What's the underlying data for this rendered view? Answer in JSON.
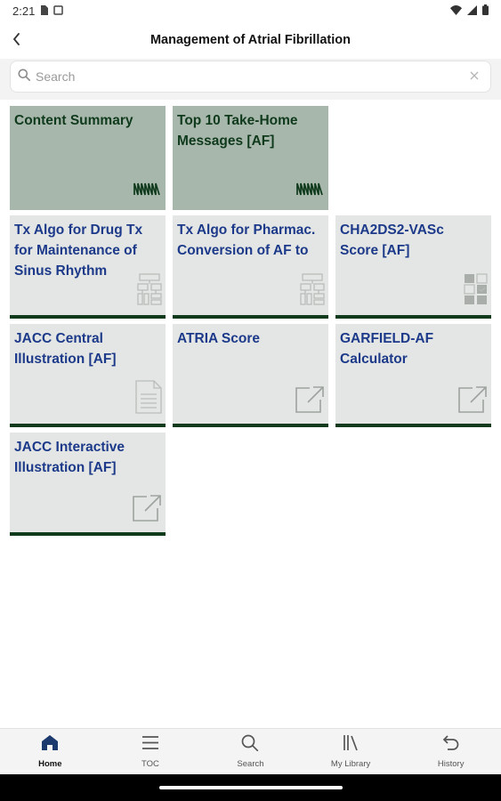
{
  "status": {
    "time": "2:21"
  },
  "header": {
    "title": "Management of Atrial Fibrillation"
  },
  "search": {
    "placeholder": "Search",
    "value": ""
  },
  "tiles": [
    {
      "label": "Content Summary",
      "icon": "waveform-icon",
      "style": "dark"
    },
    {
      "label": "Top 10 Take-Home Messages [AF]",
      "icon": "waveform-icon",
      "style": "dark"
    },
    {
      "label": "Tx Algo for Drug Tx for Maintenance of Sinus Rhythm",
      "icon": "flowchart-icon",
      "style": "light"
    },
    {
      "label": "Tx Algo for Pharmac. Conversion of AF to",
      "icon": "flowchart-icon",
      "style": "light"
    },
    {
      "label": "CHA2DS2-VASc Score [AF]",
      "icon": "calculator-grid-icon",
      "style": "light"
    },
    {
      "label": "JACC Central Illustration [AF]",
      "icon": "document-icon",
      "style": "light"
    },
    {
      "label": "ATRIA Score",
      "icon": "external-link-icon",
      "style": "light"
    },
    {
      "label": "GARFIELD-AF Calculator",
      "icon": "external-link-icon",
      "style": "light"
    },
    {
      "label": "JACC Interactive Illustration [AF]",
      "icon": "external-link-icon",
      "style": "light"
    }
  ],
  "nav": {
    "items": [
      {
        "label": "Home",
        "icon": "home-icon",
        "active": true
      },
      {
        "label": "TOC",
        "icon": "menu-icon",
        "active": false
      },
      {
        "label": "Search",
        "icon": "search-icon",
        "active": false
      },
      {
        "label": "My Library",
        "icon": "library-icon",
        "active": false
      },
      {
        "label": "History",
        "icon": "undo-icon",
        "active": false
      }
    ]
  },
  "colors": {
    "tile_dark": "#a8b7ac",
    "tile_light": "#e3e6e4",
    "tile_border": "#0f3a1c",
    "tile_text": "#1d3a8a",
    "nav_active": "#1d3a6e"
  }
}
